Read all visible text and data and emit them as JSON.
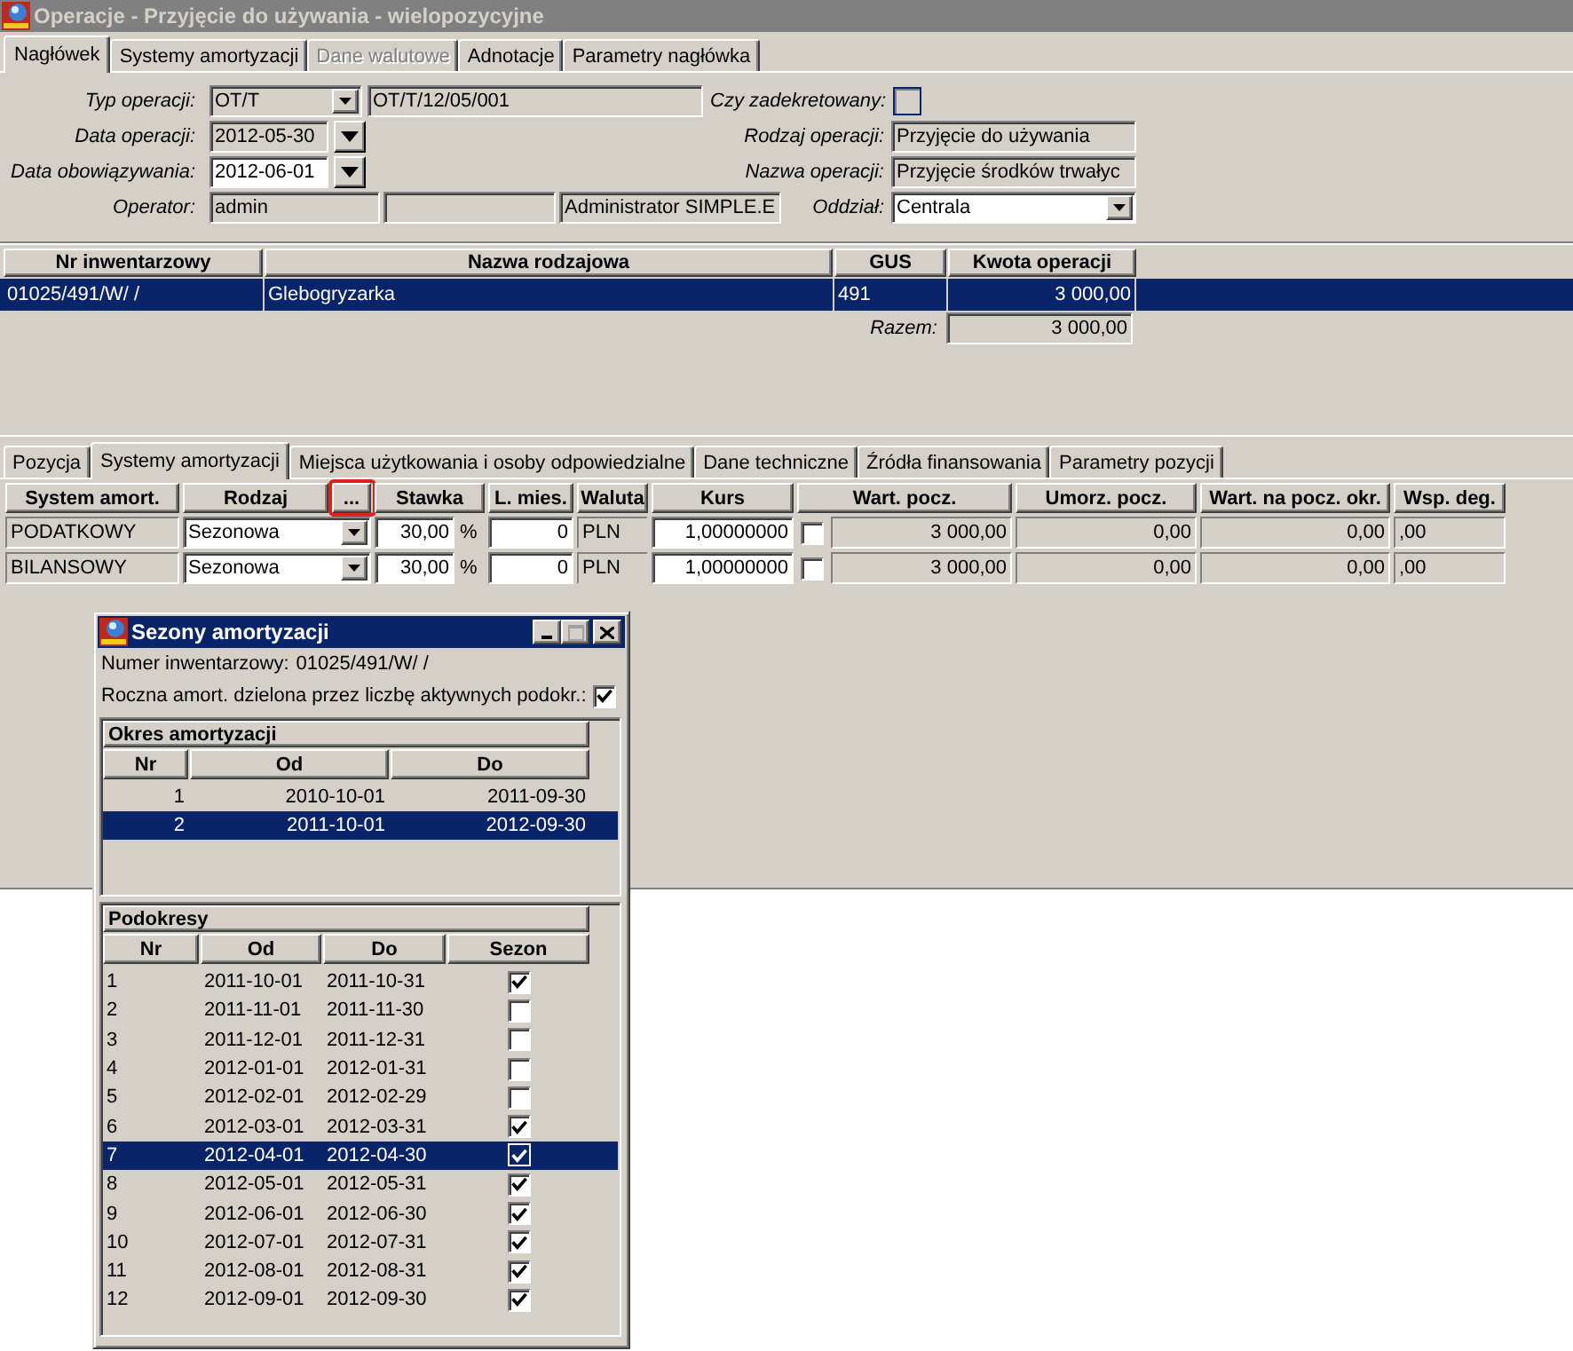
{
  "window": {
    "title": "Operacje - Przyjęcie do używania - wielopozycyjne",
    "active": false
  },
  "header_tabs": [
    {
      "label": "Nagłówek",
      "selected": true,
      "disabled": false
    },
    {
      "label": "Systemy amortyzacji",
      "selected": false,
      "disabled": false
    },
    {
      "label": "Dane walutowe",
      "selected": false,
      "disabled": true
    },
    {
      "label": "Adnotacje",
      "selected": false,
      "disabled": false
    },
    {
      "label": "Parametry nagłówka",
      "selected": false,
      "disabled": false
    }
  ],
  "header_form": {
    "rows": [
      {
        "left": {
          "kind": "combo",
          "label": "Typ operacji:",
          "value": "OT/T",
          "readonly": true,
          "document_number": "OT/T/12/05/001"
        },
        "right": {
          "kind": "checkbox",
          "label": "Czy zadekretowany:",
          "checked": false
        }
      },
      {
        "left": {
          "kind": "date",
          "label": "Data operacji:",
          "value": "2012-05-30",
          "readonly": true
        },
        "right": {
          "kind": "text",
          "label": "Rodzaj operacji:",
          "value": "Przyjęcie do używania",
          "readonly": true
        }
      },
      {
        "left": {
          "kind": "date",
          "label": "Data obowiązywania:",
          "value": "2012-06-01",
          "readonly": false
        },
        "right": {
          "kind": "text",
          "label": "Nazwa operacji:",
          "value": "Przyjęcie środków trwałyc",
          "readonly": true
        }
      },
      {
        "left": {
          "kind": "operator",
          "label": "Operator:",
          "value": "admin",
          "name": "Administrator SIMPLE.E"
        },
        "right": {
          "kind": "combo",
          "label": "Oddział:",
          "value": "Centrala",
          "readonly": false
        }
      }
    ]
  },
  "table": {
    "columns": [
      "Nr inwentarzowy",
      "Nazwa rodzajowa",
      "GUS",
      "Kwota operacji"
    ],
    "rows": [
      {
        "cells": [
          "01025/491/W/ /",
          "Glebogryzarka",
          "491",
          "3 000,00"
        ],
        "selected": true
      }
    ],
    "total_label": "Razem:",
    "total": "3 000,00"
  },
  "position_tabs": [
    {
      "label": "Pozycja",
      "selected": false
    },
    {
      "label": "Systemy amortyzacji",
      "selected": true
    },
    {
      "label": "Miejsca użytkowania i osoby odpowiedzialne",
      "selected": false
    },
    {
      "label": "Dane techniczne",
      "selected": false
    },
    {
      "label": "Źródła finansowania",
      "selected": false
    },
    {
      "label": "Parametry pozycji",
      "selected": false
    }
  ],
  "grid": {
    "columns": [
      {
        "label": "System amort.",
        "highlighted": false
      },
      {
        "label": "Rodzaj",
        "highlighted": false
      },
      {
        "label": "...",
        "highlighted": true
      },
      {
        "label": "Stawka",
        "highlighted": false
      },
      {
        "label": "L. mies.",
        "highlighted": false
      },
      {
        "label": "Waluta",
        "highlighted": false
      },
      {
        "label": "Kurs",
        "highlighted": false
      },
      {
        "label": "Wart. pocz.",
        "highlighted": false
      },
      {
        "label": "Umorz. pocz.",
        "highlighted": false
      },
      {
        "label": "Wart. na pocz. okr.",
        "highlighted": false
      },
      {
        "label": "Wsp. deg.",
        "highlighted": false
      }
    ],
    "rows": [
      {
        "system": "PODATKOWY",
        "method": "Sezonowa",
        "rate": "30,00",
        "rate_unit": "%",
        "months": "0",
        "currency": "PLN",
        "exchange_rate": "1,00000000",
        "checked": false,
        "initial_value": "3 000,00",
        "initial_depreciation": "0,00",
        "value_at_period_start": "0,00",
        "degression": ",00"
      },
      {
        "system": "BILANSOWY",
        "method": "Sezonowa",
        "rate": "30,00",
        "rate_unit": "%",
        "months": "0",
        "currency": "PLN",
        "exchange_rate": "1,00000000",
        "checked": false,
        "initial_value": "3 000,00",
        "initial_depreciation": "0,00",
        "value_at_period_start": "0,00",
        "degression": ",00"
      }
    ]
  },
  "dialog": {
    "title": "Sezony amortyzacji",
    "active": true,
    "buttons": [
      {
        "kind": "minimize",
        "disabled": false
      },
      {
        "kind": "maximize",
        "disabled": true
      },
      {
        "kind": "close",
        "disabled": false
      }
    ],
    "inventory_label": "Numer inwentarzowy:",
    "inventory_number": "01025/491/W/ /",
    "annual_label": "Roczna amort. dzielona przez liczbę aktywnych podokr.:",
    "annual_checked": true,
    "periods": {
      "title": "Okres amortyzacji",
      "columns": [
        "Nr",
        "Od",
        "Do"
      ],
      "rows": [
        {
          "nr": "1",
          "from": "2010-10-01",
          "to": "2011-09-30",
          "selected": false
        },
        {
          "nr": "2",
          "from": "2011-10-01",
          "to": "2012-09-30",
          "selected": true
        }
      ]
    },
    "subperiods": {
      "title": "Podokresy",
      "columns": [
        "Nr",
        "Od",
        "Do",
        "Sezon"
      ],
      "rows": [
        {
          "nr": "1",
          "from": "2011-10-01",
          "to": "2011-10-31",
          "season": true,
          "selected": false
        },
        {
          "nr": "2",
          "from": "2011-11-01",
          "to": "2011-11-30",
          "season": false,
          "selected": false
        },
        {
          "nr": "3",
          "from": "2011-12-01",
          "to": "2011-12-31",
          "season": false,
          "selected": false
        },
        {
          "nr": "4",
          "from": "2012-01-01",
          "to": "2012-01-31",
          "season": false,
          "selected": false
        },
        {
          "nr": "5",
          "from": "2012-02-01",
          "to": "2012-02-29",
          "season": false,
          "selected": false
        },
        {
          "nr": "6",
          "from": "2012-03-01",
          "to": "2012-03-31",
          "season": true,
          "selected": false
        },
        {
          "nr": "7",
          "from": "2012-04-01",
          "to": "2012-04-30",
          "season": true,
          "selected": true
        },
        {
          "nr": "8",
          "from": "2012-05-01",
          "to": "2012-05-31",
          "season": true,
          "selected": false
        },
        {
          "nr": "9",
          "from": "2012-06-01",
          "to": "2012-06-30",
          "season": true,
          "selected": false
        },
        {
          "nr": "10",
          "from": "2012-07-01",
          "to": "2012-07-31",
          "season": true,
          "selected": false
        },
        {
          "nr": "11",
          "from": "2012-08-01",
          "to": "2012-08-31",
          "season": true,
          "selected": false
        },
        {
          "nr": "12",
          "from": "2012-09-01",
          "to": "2012-09-30",
          "season": true,
          "selected": false
        }
      ]
    }
  }
}
